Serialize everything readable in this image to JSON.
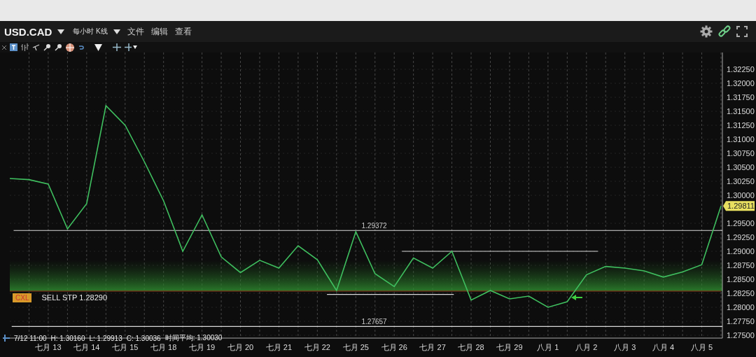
{
  "header": {
    "symbol": "USD.CAD",
    "timeframe": "每小时 K线",
    "menu": [
      {
        "label": "文件"
      },
      {
        "label": "编辑"
      },
      {
        "label": "查看"
      }
    ]
  },
  "order": {
    "button": "CXL",
    "label": "SELL STP 1.28290"
  },
  "info": [
    "7/12 11:00",
    "H: 1.30160",
    "L: 1.29913",
    "C: 1.30036",
    "时间平均: 1.30030"
  ],
  "chart_data": {
    "type": "line",
    "ylim": [
      1.2745,
      1.3255
    ],
    "grid": true,
    "categories": [
      null,
      null,
      "七月 13",
      null,
      "七月 14",
      null,
      "七月 15",
      null,
      "七月 18",
      null,
      "七月 19",
      null,
      "七月 20",
      null,
      "七月 21",
      null,
      "七月 22",
      null,
      "七月 25",
      null,
      "七月 26",
      null,
      "七月 27",
      null,
      "七月 28",
      null,
      "七月 29",
      null,
      "八月 1",
      null,
      "八月 2",
      null,
      "八月 3",
      null,
      "八月 4",
      null,
      "八月 5",
      null
    ],
    "series": [
      {
        "color": "#3fbf5f",
        "values": [
          1.303,
          1.3028,
          1.302,
          1.294,
          1.2985,
          1.316,
          1.3125,
          1.306,
          1.299,
          1.29,
          1.2965,
          1.289,
          1.2862,
          1.2884,
          1.287,
          1.291,
          1.2885,
          1.283,
          1.2935,
          1.286,
          1.2837,
          1.2888,
          1.287,
          1.29,
          1.2813,
          1.283,
          1.2815,
          1.282,
          1.28,
          1.281,
          1.2858,
          1.2873,
          1.287,
          1.2865,
          1.2854,
          1.2863,
          1.2876,
          1.2981
        ]
      }
    ],
    "yticks": [
      {
        "value": 1.275,
        "label": "1.27500"
      },
      {
        "value": 1.2775,
        "label": "1.27750"
      },
      {
        "value": 1.28,
        "label": "1.28000"
      },
      {
        "value": 1.2825,
        "label": "1.28250"
      },
      {
        "value": 1.285,
        "label": "1.28500"
      },
      {
        "value": 1.2875,
        "label": "1.28750"
      },
      {
        "value": 1.29,
        "label": "1.29000"
      },
      {
        "value": 1.2925,
        "label": "1.29250"
      },
      {
        "value": 1.295,
        "label": "1.29500"
      },
      {
        "value": 1.3,
        "label": "1.30000"
      },
      {
        "value": 1.3025,
        "label": "1.30250"
      },
      {
        "value": 1.305,
        "label": "1.30500"
      },
      {
        "value": 1.3075,
        "label": "1.30750"
      },
      {
        "value": 1.31,
        "label": "1.31000"
      },
      {
        "value": 1.3125,
        "label": "1.31250"
      },
      {
        "value": 1.315,
        "label": "1.31500"
      },
      {
        "value": 1.3175,
        "label": "1.31750"
      },
      {
        "value": 1.32,
        "label": "1.32000"
      },
      {
        "value": 1.3225,
        "label": "1.32250"
      }
    ],
    "ref_lines": [
      {
        "axis": "y",
        "value": 1.29372,
        "label": "1.29372"
      },
      {
        "axis": "y",
        "value": 1.27657,
        "label": "1.27657"
      },
      {
        "axis": "y",
        "value": 1.29
      },
      {
        "axis": "y",
        "value": 1.2823
      },
      {
        "axis": "y",
        "value": 1.2829,
        "color": "#7a3a1a"
      }
    ],
    "bands": [
      {
        "axis": "y",
        "from": 1.2829,
        "to": 1.2885
      }
    ],
    "annotations": [
      {
        "text": "1.29811"
      }
    ]
  }
}
